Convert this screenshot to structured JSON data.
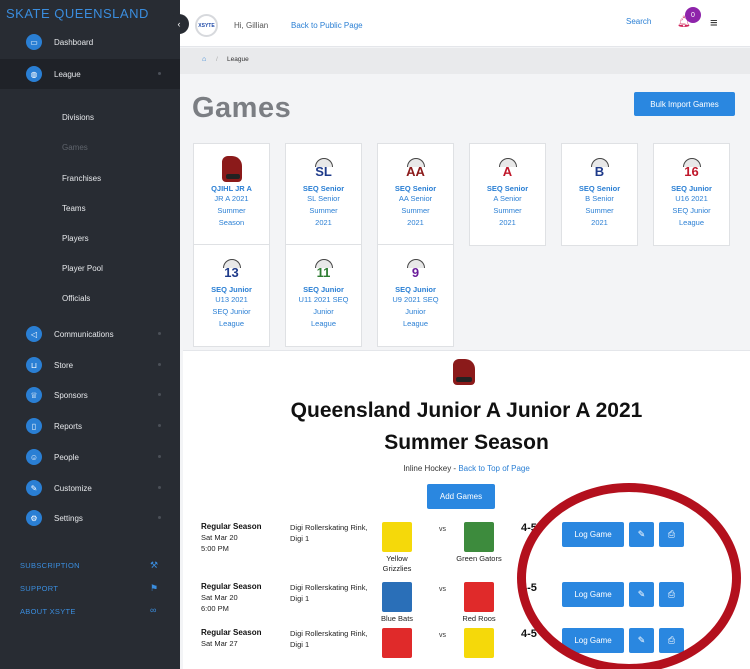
{
  "sidebar": {
    "brand": "SKATE QUEENSLAND",
    "items": [
      {
        "label": "Dashboard",
        "icon": "monitor-icon"
      },
      {
        "label": "League",
        "icon": "globe-icon"
      },
      {
        "label": "Communications",
        "icon": "megaphone-icon"
      },
      {
        "label": "Store",
        "icon": "cart-icon"
      },
      {
        "label": "Sponsors",
        "icon": "crown-icon"
      },
      {
        "label": "Reports",
        "icon": "document-icon"
      },
      {
        "label": "People",
        "icon": "user-icon"
      },
      {
        "label": "Customize",
        "icon": "paint-icon"
      },
      {
        "label": "Settings",
        "icon": "gear-icon"
      }
    ],
    "league_sub": [
      "Divisions",
      "Games",
      "Franchises",
      "Teams",
      "Players",
      "Player Pool",
      "Officials"
    ],
    "bottom": [
      {
        "label": "SUBSCRIPTION",
        "icon": "wrench-icon"
      },
      {
        "label": "SUPPORT",
        "icon": "flag-icon"
      },
      {
        "label": "ABOUT XSYTE",
        "icon": "infinity-icon"
      }
    ]
  },
  "topbar": {
    "logo_text": "XSYTE",
    "greeting": "Hi, Gillian",
    "back_link": "Back to Public Page",
    "search": "Search",
    "notification_count": "0"
  },
  "breadcrumb": {
    "current": "League"
  },
  "page": {
    "title": "Games",
    "bulk_import": "Bulk Import Games"
  },
  "divisions": [
    {
      "name": "QJIHL JR A",
      "lines": [
        "JR A 2021",
        "Summer",
        "Season"
      ],
      "logo": "mascot"
    },
    {
      "name": "SEQ Senior",
      "lines": [
        "SL Senior",
        "Summer",
        "2021"
      ],
      "logo": "SL",
      "color": "#1e3a8a"
    },
    {
      "name": "SEQ Senior",
      "lines": [
        "AA Senior",
        "Summer",
        "2021"
      ],
      "logo": "AA",
      "color": "#8b1a1a"
    },
    {
      "name": "SEQ Senior",
      "lines": [
        "A Senior",
        "Summer",
        "2021"
      ],
      "logo": "A",
      "color": "#c0182b"
    },
    {
      "name": "SEQ Senior",
      "lines": [
        "B Senior",
        "Summer",
        "2021"
      ],
      "logo": "B",
      "color": "#1e3a8a"
    },
    {
      "name": "SEQ Junior",
      "lines": [
        "U16 2021",
        "SEQ Junior",
        "League"
      ],
      "logo": "16",
      "color": "#c0182b"
    },
    {
      "name": "SEQ Junior",
      "lines": [
        "U13 2021",
        "SEQ Junior",
        "League"
      ],
      "logo": "13",
      "color": "#1e3a8a"
    },
    {
      "name": "SEQ Junior",
      "lines": [
        "U11 2021 SEQ",
        "Junior",
        "League"
      ],
      "logo": "11",
      "color": "#2e7d32"
    },
    {
      "name": "SEQ Junior",
      "lines": [
        "U9 2021 SEQ",
        "Junior",
        "League"
      ],
      "logo": "9",
      "color": "#6a1b9a"
    }
  ],
  "season": {
    "title_line1": "Queensland Junior A Junior A 2021",
    "title_line2": "Summer Season",
    "sport": "Inline Hockey - ",
    "back_top": "Back to Top of Page",
    "add_games": "Add Games"
  },
  "games": [
    {
      "type": "Regular Season",
      "date": "Sat Mar 20",
      "time": "5:00 PM",
      "venue": "Digi Rollerskating Rink, Digi 1",
      "home": "Yellow Grizzlies",
      "home_color": "#f5d90a",
      "away": "Green Gators",
      "away_color": "#3d8b3d",
      "score": "4-5"
    },
    {
      "type": "Regular Season",
      "date": "Sat Mar 20",
      "time": "6:00 PM",
      "venue": "Digi Rollerskating Rink, Digi 1",
      "home": "Blue Bats",
      "home_color": "#2a6fb8",
      "away": "Red Roos",
      "away_color": "#e02a2a",
      "score": "4-5"
    },
    {
      "type": "Regular Season",
      "date": "Sat Mar 27",
      "time": "",
      "venue": "Digi Rollerskating Rink, Digi 1",
      "home": "",
      "home_color": "#e02a2a",
      "away": "",
      "away_color": "#f5d90a",
      "score": "4-5"
    }
  ],
  "labels": {
    "vs": "vs",
    "log_game": "Log Game"
  },
  "colors": {
    "accent": "#2a87e0",
    "sidebar_bg": "#282c33",
    "annotation": "#b3101d"
  }
}
